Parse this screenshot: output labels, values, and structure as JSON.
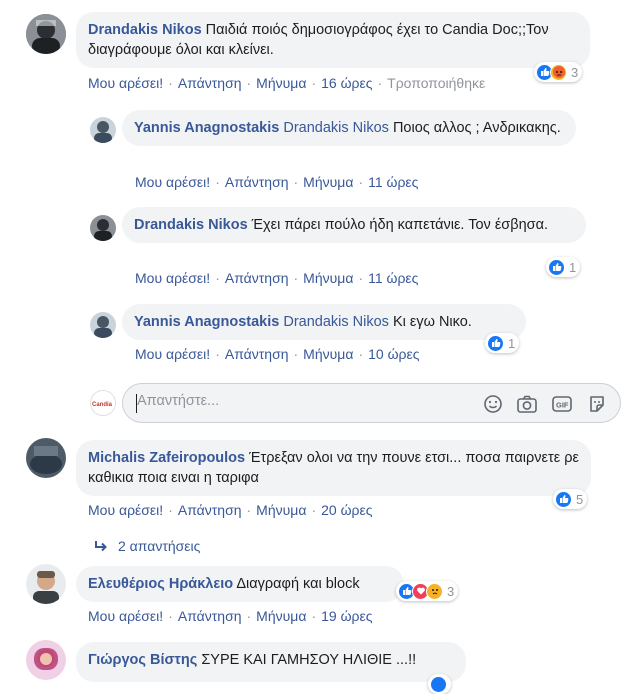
{
  "actions": {
    "like": "Μου αρέσει!",
    "reply": "Απάντηση",
    "message": "Μήνυμα",
    "edited": "Τροποποιήθηκε"
  },
  "comments": [
    {
      "author": "Drandakis Nikos",
      "text": "Παιδιά ποιός δημοσιογράφος έχει το Candia Doc;;Τον διαγράφουμε όλοι και κλείνει.",
      "time": "16 ώρες",
      "reaction_count": "3"
    },
    {
      "author": "Yannis Anagnostakis",
      "mention": "Drandakis Nikos",
      "text": "Ποιος αλλος ; Ανδρικακης.",
      "time": "11 ώρες"
    },
    {
      "author": "Drandakis Nikos",
      "text": "Έχει πάρει πούλο ήδη καπετάνιε. Τον έσβησα.",
      "time": "11 ώρες",
      "reaction_count": "1"
    },
    {
      "author": "Yannis Anagnostakis",
      "mention": "Drandakis Nikos",
      "text": "Κι εγω Νικο.",
      "time": "10 ώρες",
      "reaction_count": "1"
    },
    {
      "author": "Michalis Zafeiropoulos",
      "text": "Έτρεξαν ολοι να την πουνε ετσι... ποσα παιρνετε ρε καθικια ποια ειναι η ταριφα",
      "time": "20 ώρες",
      "reaction_count": "5"
    },
    {
      "author": "Ελευθέριος Ηράκλειο",
      "text": "Διαγραφή και block",
      "time": "19 ώρες",
      "reaction_count": "3"
    },
    {
      "author": "Γιώργος Βίστης",
      "text": "ΣΥΡΕ ΚΑΙ ΓΑΜΗΣΟΥ ΗΛΙΘΙΕ ...!!"
    }
  ],
  "reply_box": {
    "placeholder": "Απαντήστε...",
    "page_avatar_text": "CandiaDOC"
  },
  "replies_link": "2 απαντήσεις",
  "colors": {
    "link": "#385898",
    "bubble": "#f2f3f5",
    "like": "#1877f2",
    "love": "#f33e58",
    "angry": "#f7b125"
  }
}
